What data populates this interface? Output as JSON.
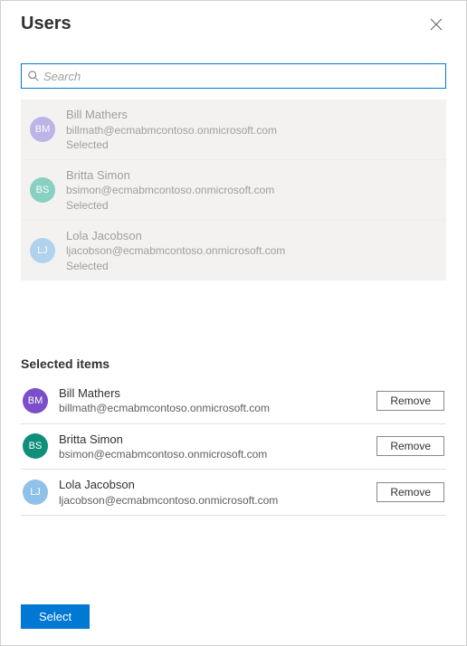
{
  "header": {
    "title": "Users"
  },
  "search": {
    "placeholder": "Search",
    "value": ""
  },
  "colors": {
    "avatar_purple": "#a093e2",
    "avatar_teal": "#4fc0a9",
    "avatar_blue": "#8fc2ea"
  },
  "results": [
    {
      "initials": "BM",
      "name": "Bill Mathers",
      "email": "billmath@ecmabmcontoso.onmicrosoft.com",
      "status": "Selected",
      "avatar_color": "#a093e2"
    },
    {
      "initials": "BS",
      "name": "Britta Simon",
      "email": "bsimon@ecmabmcontoso.onmicrosoft.com",
      "status": "Selected",
      "avatar_color": "#4fc0a9"
    },
    {
      "initials": "LJ",
      "name": "Lola Jacobson",
      "email": "ljacobson@ecmabmcontoso.onmicrosoft.com",
      "status": "Selected",
      "avatar_color": "#8fc2ea"
    }
  ],
  "selected_section": {
    "title": "Selected items",
    "remove_label": "Remove"
  },
  "selected": [
    {
      "initials": "BM",
      "name": "Bill Mathers",
      "email": "billmath@ecmabmcontoso.onmicrosoft.com",
      "avatar_color": "#7b4fc9"
    },
    {
      "initials": "BS",
      "name": "Britta Simon",
      "email": "bsimon@ecmabmcontoso.onmicrosoft.com",
      "avatar_color": "#0f8f7a"
    },
    {
      "initials": "LJ",
      "name": "Lola Jacobson",
      "email": "ljacobson@ecmabmcontoso.onmicrosoft.com",
      "avatar_color": "#8fc2ea"
    }
  ],
  "footer": {
    "select_label": "Select"
  }
}
